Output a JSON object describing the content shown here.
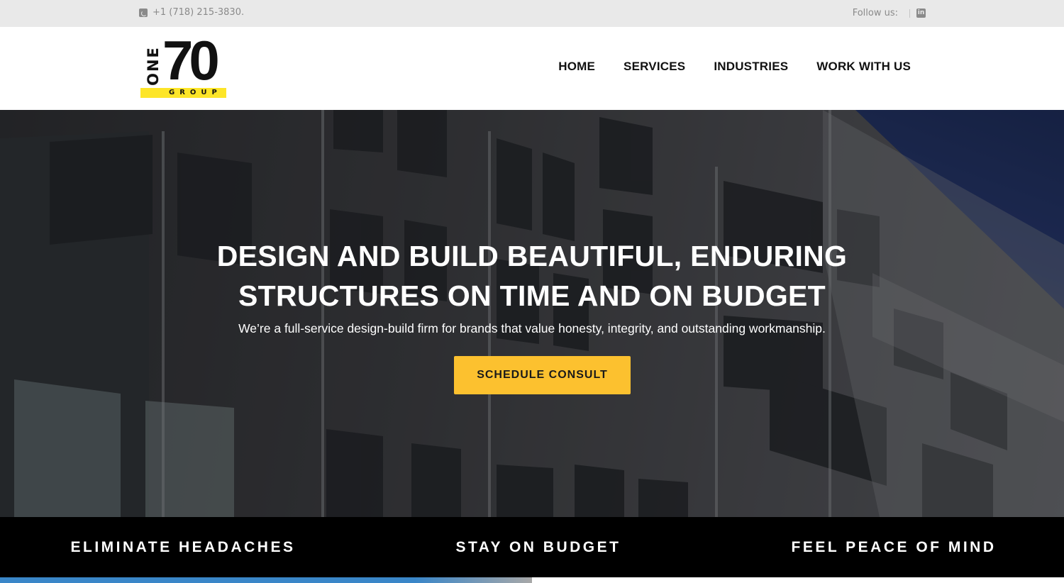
{
  "topbar": {
    "phone": "+1 (718) 215-3830.",
    "follow_label": "Follow us:",
    "social_icon": "linkedin-icon"
  },
  "logo": {
    "vertical_text": "ONE",
    "number": "70",
    "group_text": "GROUP",
    "accent_color": "#fde528"
  },
  "nav": {
    "items": [
      {
        "label": "HOME"
      },
      {
        "label": "SERVICES"
      },
      {
        "label": "INDUSTRIES"
      },
      {
        "label": "WORK WITH US"
      }
    ]
  },
  "hero": {
    "headline_line1": "DESIGN AND BUILD BEAUTIFUL, ENDURING",
    "headline_line2": "STRUCTURES ON TIME AND ON BUDGET",
    "subheadline": "We’re a full-service design-build firm for brands that value honesty, integrity, and outstanding workmanship.",
    "cta_label": "SCHEDULE CONSULT",
    "cta_color": "#fcc12f"
  },
  "features": [
    {
      "label": "ELIMINATE HEADACHES"
    },
    {
      "label": "STAY ON BUDGET"
    },
    {
      "label": "FEEL PEACE OF MIND"
    }
  ]
}
